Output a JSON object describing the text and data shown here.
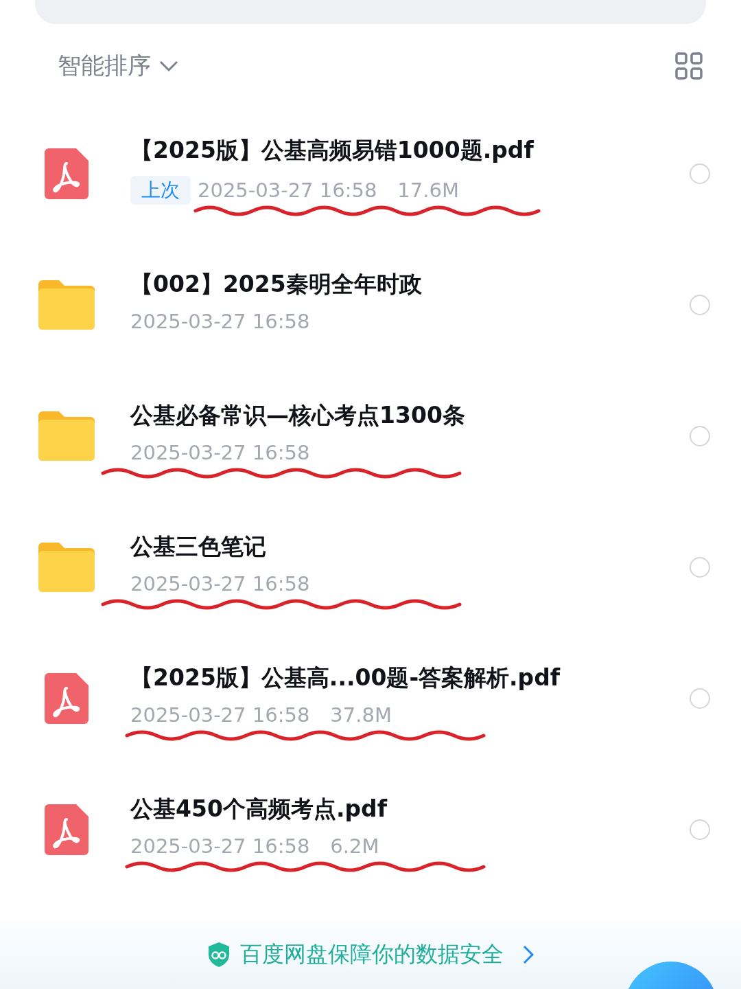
{
  "sort": {
    "label": "智能排序"
  },
  "files": [
    {
      "kind": "pdf",
      "name": "【2025版】公基高频易错1000题.pdf",
      "tag": "上次",
      "date": "2025-03-27 16:58",
      "size": "17.6M",
      "selected": false,
      "scribbled": true
    },
    {
      "kind": "folder",
      "name": "【002】2025秦明全年时政",
      "date": "2025-03-27 16:58",
      "selected": false,
      "scribbled": false
    },
    {
      "kind": "folder",
      "name": "公基必备常识—核心考点1300条",
      "date": "2025-03-27 16:58",
      "selected": false,
      "scribbled": true
    },
    {
      "kind": "folder",
      "name": "公基三色笔记",
      "date": "2025-03-27 16:58",
      "selected": false,
      "scribbled": true
    },
    {
      "kind": "pdf",
      "name": "【2025版】公基高...00题-答案解析.pdf",
      "date": "2025-03-27 16:58",
      "size": "37.8M",
      "selected": false,
      "scribbled": true
    },
    {
      "kind": "pdf",
      "name": "公基450个高频考点.pdf",
      "date": "2025-03-27 16:58",
      "size": "6.2M",
      "selected": false,
      "scribbled": true
    }
  ],
  "banner": {
    "text": "百度网盘保障你的数据安全"
  }
}
